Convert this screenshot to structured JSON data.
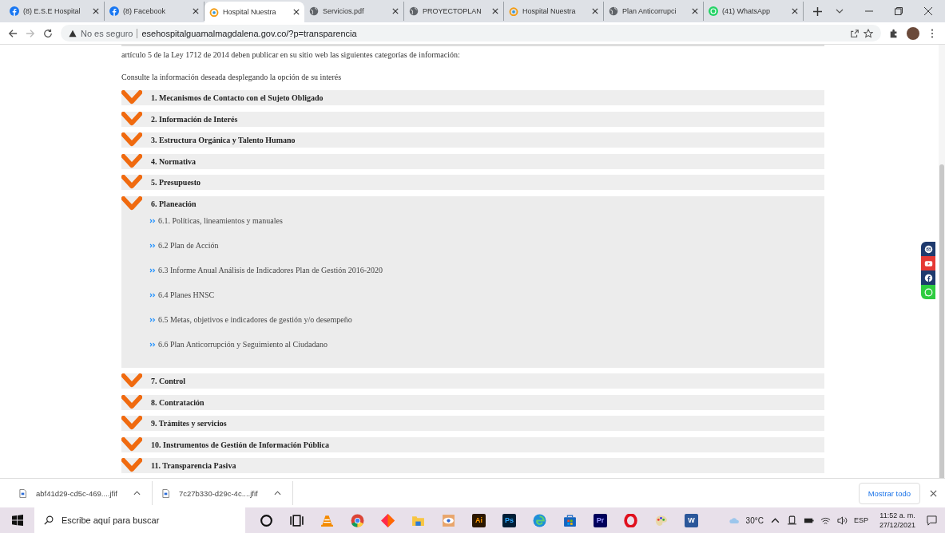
{
  "browser": {
    "tabs": [
      {
        "title": "(8) E.S.E Hospital",
        "kind": "facebook",
        "selected": false
      },
      {
        "title": "(8) Facebook",
        "kind": "facebook",
        "selected": false
      },
      {
        "title": "Hospital Nuestra",
        "kind": "hospital",
        "selected": true
      },
      {
        "title": "Servicios.pdf",
        "kind": "globe",
        "selected": false
      },
      {
        "title": "PROYECTOPLAN",
        "kind": "globe",
        "selected": false
      },
      {
        "title": "Hospital Nuestra",
        "kind": "hospital",
        "selected": false
      },
      {
        "title": "Plan Anticorrupci",
        "kind": "globe",
        "selected": false
      },
      {
        "title": "(41) WhatsApp",
        "kind": "whatsapp",
        "selected": false
      }
    ],
    "security": "No es seguro",
    "url": "esehospitalguamalmagdalena.gov.co/?p=transparencia"
  },
  "page": {
    "intro": "artículo 5 de la Ley 1712 de 2014 deben publicar en su sitio web las siguientes categorías de información:",
    "prompt": "Consulte la información deseada desplegando la opción de su interés",
    "sections": [
      {
        "title": "1. Mecanismos de Contacto con el Sujeto Obligado",
        "expanded": false
      },
      {
        "title": "2. Información de Interés",
        "expanded": false
      },
      {
        "title": "3. Estructura Orgánica y Talento Humano",
        "expanded": false
      },
      {
        "title": "4. Normativa",
        "expanded": false
      },
      {
        "title": "5. Presupuesto",
        "expanded": false
      },
      {
        "title": "6. Planeación",
        "expanded": true,
        "children": [
          {
            "title": "6.1. Políticas, lineamientos y manuales"
          },
          {
            "title": "6.2 Plan de Acción"
          },
          {
            "title": "6.3 Informe Anual Análisis de Indicadores Plan de Gestión 2016-2020"
          },
          {
            "title": "6.4 Planes HNSC"
          },
          {
            "title": "6.5 Metas, objetivos e indicadores de gestión y/o desempeño"
          },
          {
            "title": "6.6 Plan Anticorrupción y Seguimiento al Ciudadano"
          }
        ]
      },
      {
        "title": "7. Control",
        "expanded": false
      },
      {
        "title": "8. Contratación",
        "expanded": false
      },
      {
        "title": "9. Trámites y servicios",
        "expanded": false
      },
      {
        "title": "10. Instrumentos de Gestión de Información Pública",
        "expanded": false
      },
      {
        "title": "11. Transparencia Pasiva",
        "expanded": false
      }
    ],
    "social": [
      {
        "kind": "email",
        "color": "#1e3a6e"
      },
      {
        "kind": "youtube",
        "color": "#e53935"
      },
      {
        "kind": "facebook",
        "color": "#1e3a6e"
      },
      {
        "kind": "whatsapp",
        "color": "#2ecc40"
      }
    ]
  },
  "downloads": {
    "files": [
      "abf41d29-cd5c-469....jfif",
      "7c27b330-d29c-4c....jfif"
    ],
    "show_all": "Mostrar todo"
  },
  "taskbar": {
    "search_placeholder": "Escribe aquí para buscar",
    "apps": [
      {
        "kind": "cortana"
      },
      {
        "kind": "taskview"
      },
      {
        "kind": "vlc"
      },
      {
        "kind": "chrome"
      },
      {
        "kind": "diamond"
      },
      {
        "kind": "folder"
      },
      {
        "kind": "paint"
      },
      {
        "kind": "letter",
        "label": "Ai",
        "color": "#2b1700"
      },
      {
        "kind": "letter",
        "label": "Ps",
        "color": "#001e36"
      },
      {
        "kind": "edge"
      },
      {
        "kind": "store"
      },
      {
        "kind": "letter",
        "label": "Pr",
        "color": "#00005b"
      },
      {
        "kind": "opera"
      },
      {
        "kind": "palette"
      },
      {
        "kind": "letter",
        "label": "W",
        "color": "#2b579a"
      }
    ],
    "temperature": "30°C",
    "language": "ESP",
    "time": "11:52 a. m.",
    "date": "27/12/2021"
  }
}
